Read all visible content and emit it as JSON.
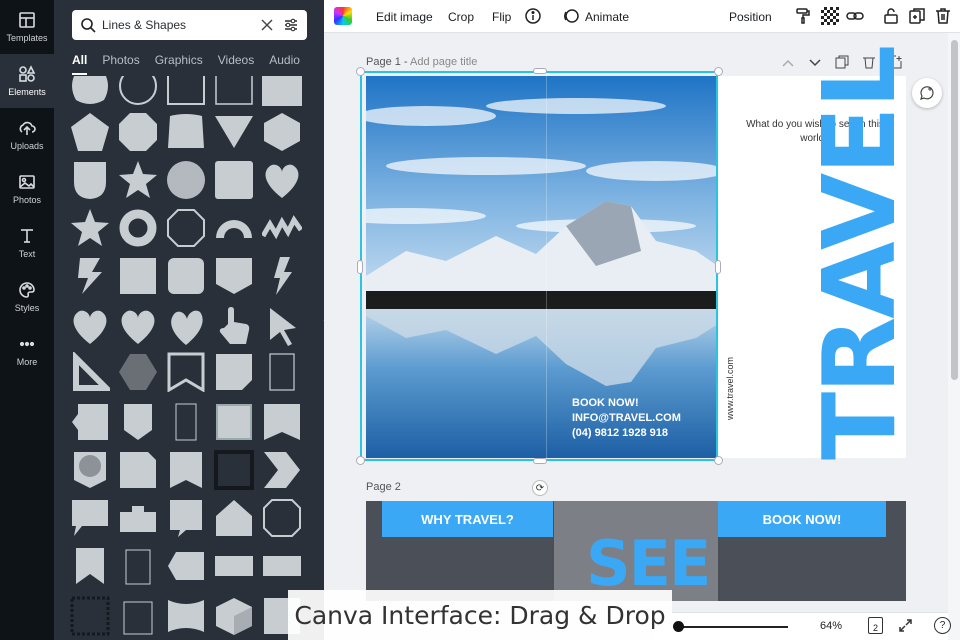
{
  "rail": {
    "items": [
      {
        "label": "Templates",
        "icon": "templates-icon"
      },
      {
        "label": "Elements",
        "icon": "elements-icon",
        "active": true
      },
      {
        "label": "Uploads",
        "icon": "uploads-icon"
      },
      {
        "label": "Photos",
        "icon": "photos-icon"
      },
      {
        "label": "Text",
        "icon": "text-icon"
      },
      {
        "label": "Styles",
        "icon": "styles-icon"
      },
      {
        "label": "More",
        "icon": "more-icon"
      }
    ]
  },
  "panel": {
    "search_value": "Lines & Shapes",
    "tabs": [
      "All",
      "Photos",
      "Graphics",
      "Videos",
      "Audio"
    ],
    "active_tab": "All",
    "shape_color": "#c8cdd2"
  },
  "toolbar": {
    "edit_image": "Edit image",
    "crop": "Crop",
    "flip": "Flip",
    "animate": "Animate",
    "position": "Position"
  },
  "page1": {
    "label": "Page 1 - ",
    "add_title": "Add page title",
    "book_now": "BOOK NOW!",
    "email": "INFO@TRAVEL.COM",
    "phone": "(04) 9812 1928 918",
    "question": "What do you wish to see in this world?",
    "url": "www.travel.com",
    "headline": "TRAVEL"
  },
  "page2": {
    "label": "Page 2",
    "left_banner": "WHY TRAVEL?",
    "right_banner": "BOOK NOW!",
    "center_word": "SEE"
  },
  "footer": {
    "zoom": "64%",
    "page_count": "2",
    "help": "?"
  },
  "caption": "Canva Interface: Drag & Drop",
  "colors": {
    "accent": "#3aa8f4",
    "selection": "#27c4e3",
    "panel_bg": "#293039",
    "rail_bg": "#0e1318"
  }
}
